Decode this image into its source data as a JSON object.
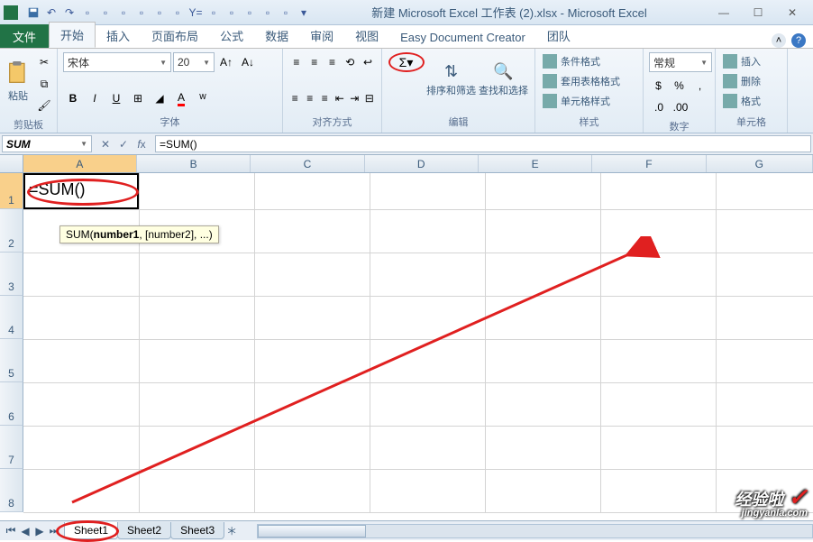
{
  "title": "新建 Microsoft Excel 工作表 (2).xlsx - Microsoft Excel",
  "tabs": {
    "file": "文件",
    "home": "开始",
    "insert": "插入",
    "layout": "页面布局",
    "formulas": "公式",
    "data": "数据",
    "review": "审阅",
    "view": "视图",
    "edc": "Easy Document Creator",
    "team": "团队"
  },
  "ribbon": {
    "clipboard": {
      "label": "剪贴板",
      "paste": "粘贴"
    },
    "font": {
      "label": "字体",
      "name": "宋体",
      "size": "20",
      "bold": "B",
      "italic": "I",
      "underline": "U"
    },
    "align": {
      "label": "对齐方式"
    },
    "edit": {
      "label": "编辑",
      "autosum": "Σ",
      "sortfilter": "排序和筛选",
      "findselect": "查找和选择"
    },
    "styles": {
      "label": "样式",
      "cond": "条件格式",
      "table": "套用表格格式",
      "cell": "单元格样式"
    },
    "number": {
      "label": "数字",
      "format": "常规"
    },
    "cells": {
      "label": "单元格",
      "insert": "插入",
      "delete": "删除",
      "format": "格式"
    }
  },
  "formulabar": {
    "name": "SUM",
    "formula": "=SUM()"
  },
  "columns": [
    "A",
    "B",
    "C",
    "D",
    "E",
    "F",
    "G"
  ],
  "rows": [
    "1",
    "2",
    "3",
    "4",
    "5",
    "6",
    "7",
    "8"
  ],
  "cell_a1": "=SUM()",
  "tooltip": {
    "fn": "SUM(",
    "arg1": "number1",
    "rest": ", [number2], ...)"
  },
  "sheets": {
    "s1": "Sheet1",
    "s2": "Sheet2",
    "s3": "Sheet3"
  },
  "watermark": {
    "brand": "经验啦",
    "url": "jingyanla.com"
  }
}
